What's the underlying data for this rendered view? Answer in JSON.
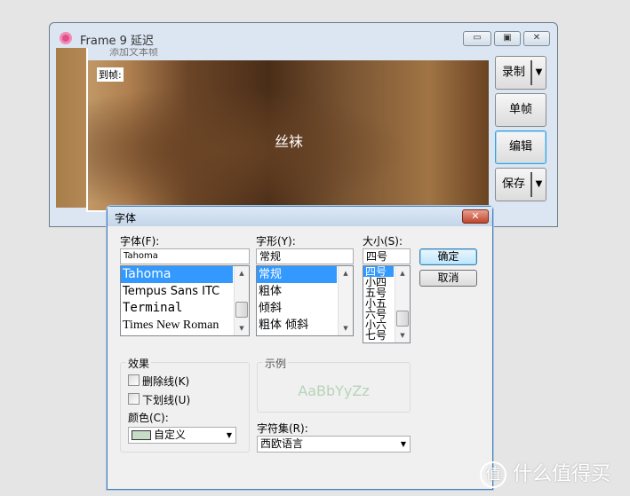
{
  "main_window": {
    "title": "Frame 9 延迟",
    "minimize": "▭",
    "maximize": "▣",
    "close": "✕",
    "inner_title": "添加文本帧",
    "frame_label": "到帧:",
    "overlay_text": "丝袜",
    "buttons": {
      "record": "录制",
      "single_frame": "单帧",
      "edit": "编辑",
      "save": "保存"
    }
  },
  "font_dialog": {
    "title": "字体",
    "close": "✕",
    "font_label": "字体(F):",
    "font_value": "Tahoma",
    "fonts": [
      "Tahoma",
      "Tempus Sans ITC",
      "Terminal",
      "Times New Roman"
    ],
    "style_label": "字形(Y):",
    "style_value": "常规",
    "styles": [
      "常规",
      "粗体",
      "倾斜",
      "粗体 倾斜"
    ],
    "size_label": "大小(S):",
    "size_value": "四号",
    "sizes": [
      "四号",
      "小四",
      "五号",
      "小五",
      "六号",
      "小六",
      "七号"
    ],
    "ok": "确定",
    "cancel": "取消",
    "effects_label": "效果",
    "strikeout": "删除线(K)",
    "underline": "下划线(U)",
    "color_label": "颜色(C):",
    "color_value": "自定义",
    "color_swatch": "#c6dcc6",
    "sample_label": "示例",
    "sample_text": "AaBbYyZz",
    "sample_color": "#b7d4b7",
    "charset_label": "字符集(R):",
    "charset_value": "西欧语言"
  },
  "watermark": {
    "icon": "值",
    "text": "什么值得买"
  }
}
